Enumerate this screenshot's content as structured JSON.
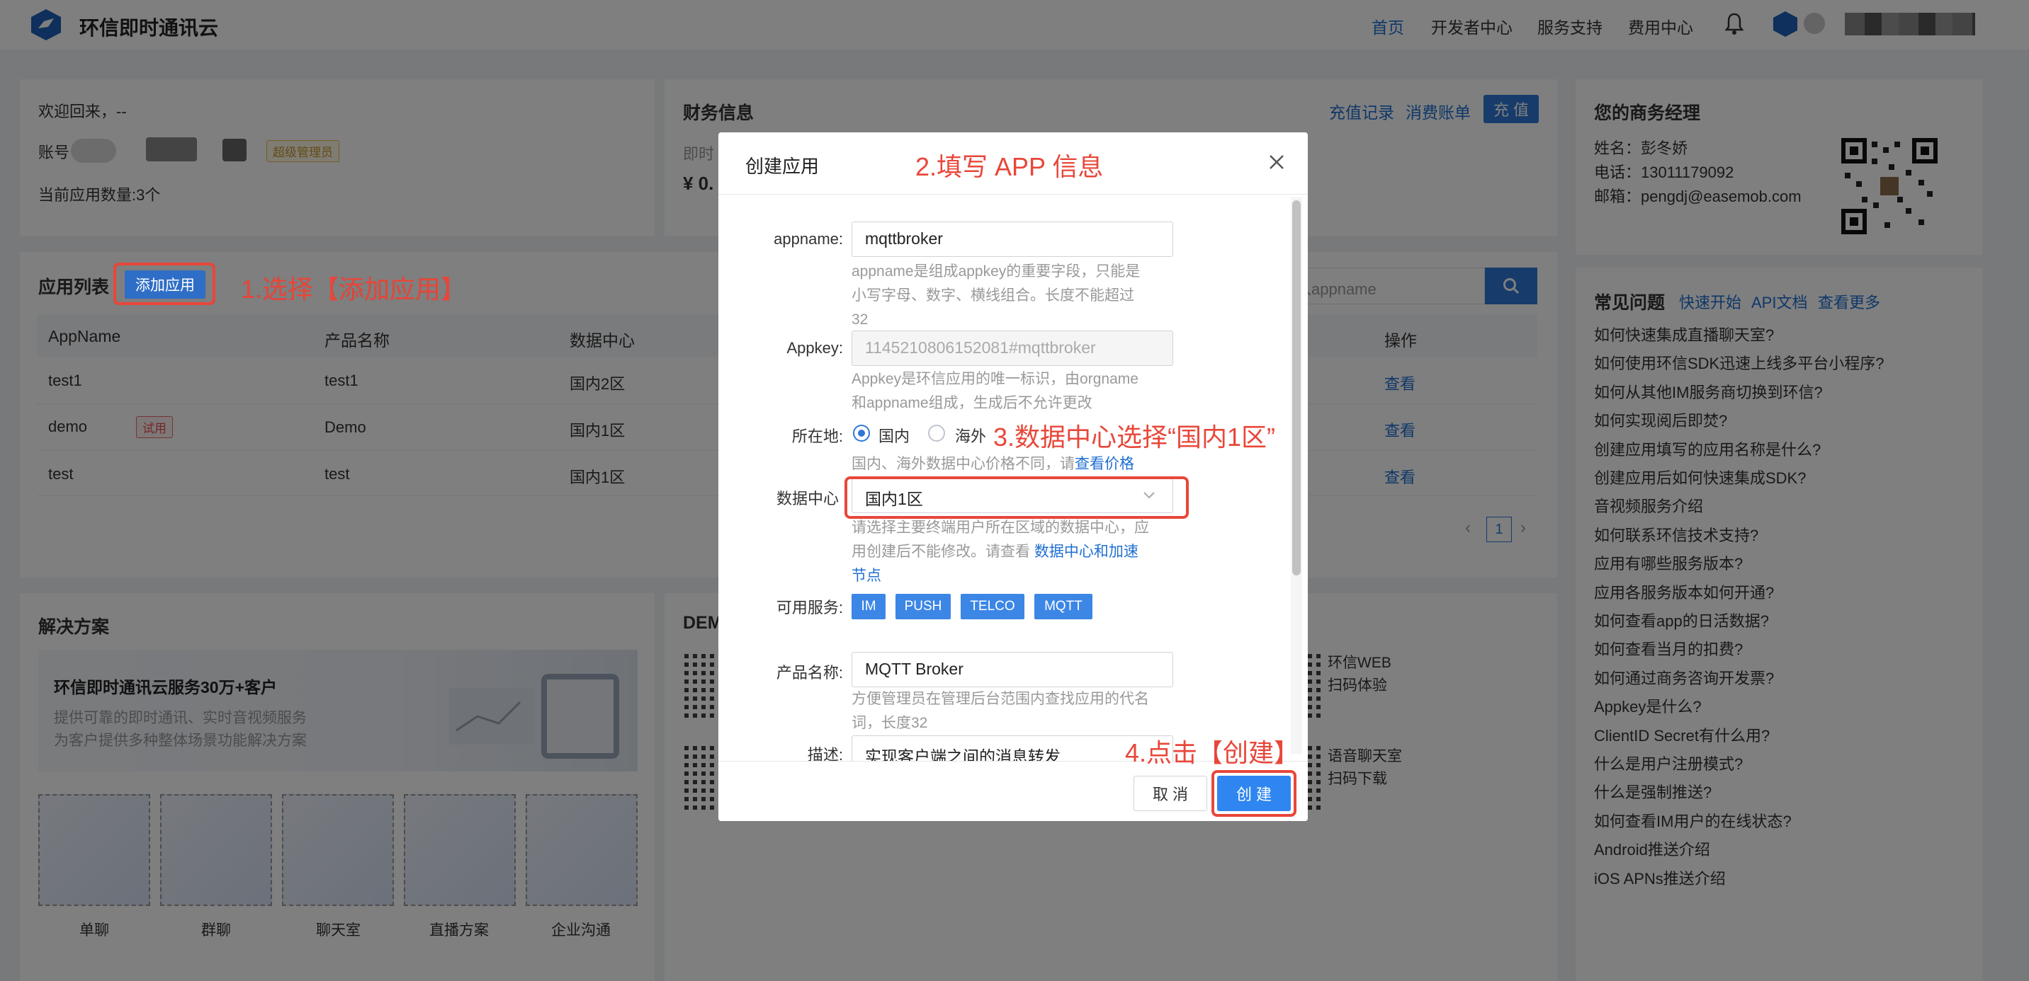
{
  "header": {
    "brand": "环信即时通讯云",
    "nav": [
      "首页",
      "开发者中心",
      "服务支持",
      "费用中心"
    ]
  },
  "welcome": {
    "greeting": "欢迎回来，--",
    "account_label": "账号",
    "admin_tag": "超级管理员",
    "app_count": "当前应用数量:3个"
  },
  "finance": {
    "title": "财务信息",
    "recharge_log": "充值记录",
    "bill": "消费账单",
    "recharge_btn": "充 值",
    "label_partial": "即时",
    "amount_partial": "¥ 0."
  },
  "manager": {
    "title": "您的商务经理",
    "name": "姓名：彭冬娇",
    "phone": "电话：13011179092",
    "email": "邮箱：pengdj@easemob.com"
  },
  "applist": {
    "title": "应用列表",
    "add_btn": "添加应用",
    "search_placeholder": "入appname",
    "columns": [
      "AppName",
      "产品名称",
      "数据中心",
      "操作"
    ],
    "rows": [
      {
        "app": "test1",
        "product": "test1",
        "dc": "国内2区",
        "op": "查看",
        "trial": ""
      },
      {
        "app": "demo",
        "product": "Demo",
        "dc": "国内1区",
        "op": "查看",
        "trial": "试用"
      },
      {
        "app": "test",
        "product": "test",
        "dc": "国内1区",
        "op": "查看",
        "trial": ""
      }
    ],
    "page": "1"
  },
  "faq": {
    "title": "常见问题",
    "links": [
      "快速开始",
      "API文档",
      "查看更多"
    ],
    "items": [
      "如何快速集成直播聊天室?",
      "如何使用环信SDK迅速上线多平台小程序?",
      "如何从其他IM服务商切换到环信?",
      "如何实现阅后即焚?",
      "创建应用填写的应用名称是什么?",
      "创建应用后如何快速集成SDK?",
      "音视频服务介绍",
      "如何联系环信技术支持?",
      "应用有哪些服务版本?",
      "应用各服务版本如何开通?",
      "如何查看app的日活数据?",
      "如何查看当月的扣费?",
      "如何通过商务咨询开发票?",
      "Appkey是什么?",
      "ClientID Secret有什么用?",
      "什么是用户注册模式?",
      "什么是强制推送?",
      "如何查看IM用户的在线状态?",
      "Android推送介绍",
      "iOS APNs推送介绍"
    ]
  },
  "solutions": {
    "title": "解决方案",
    "banner_title": "环信即时通讯云服务30万+客户",
    "banner_line1": "提供可靠的即时通讯、实时音视频服务",
    "banner_line2": "为客户提供多种整体场景功能解决方案",
    "items": [
      "单聊",
      "群聊",
      "聊天室",
      "直播方案",
      "企业沟通"
    ]
  },
  "demo": {
    "title_partial": "DEM",
    "item1_line1": "环信WEB",
    "item1_line2": "扫码体验",
    "item2_line1": "语音聊天室",
    "item2_line2": "扫码下载"
  },
  "modal": {
    "title": "创建应用",
    "appname_label": "appname:",
    "appname_value": "mqttbroker",
    "appname_help1": "appname是组成appkey的重要字段，只能是",
    "appname_help2": "小写字母、数字、横线组合。长度不能超过",
    "appname_help3": "32",
    "appkey_label": "Appkey:",
    "appkey_value": "1145210806152081#mqttbroker",
    "appkey_help1": "Appkey是环信应用的唯一标识，由orgname",
    "appkey_help2": "和appname组成，生成后不允许更改",
    "location_label": "所在地:",
    "location_domestic": "国内",
    "location_overseas": "海外",
    "location_help": "国内、海外数据中心价格不同，请",
    "location_help_link": "查看价格",
    "dc_label": "数据中心",
    "dc_value": "国内1区",
    "dc_help1": "请选择主要终端用户所在区域的数据中心，应",
    "dc_help2": "用创建后不能修改。请查看",
    "dc_help_link1": "数据中心和加速",
    "dc_help_link2": "节点",
    "services_label": "可用服务:",
    "services": [
      "IM",
      "PUSH",
      "TELCO",
      "MQTT"
    ],
    "product_label": "产品名称:",
    "product_value": "MQTT Broker",
    "product_help1": "方便管理员在管理后台范围内查找应用的代名",
    "product_help2": "词，长度32",
    "desc_label": "描述:",
    "desc_value": "实现客户端之间的消息转发",
    "cancel": "取 消",
    "create": "创 建"
  },
  "annotations": {
    "step1": "1.选择【添加应用】",
    "step2": "2.填写 APP 信息",
    "step3": "3.数据中心选择“国内1区”",
    "step4": "4.点击【创建】"
  },
  "colors": {
    "primary": "#2f78d6",
    "annotation": "#e8473a",
    "overlay": "rgba(0,0,0,0.5)"
  }
}
